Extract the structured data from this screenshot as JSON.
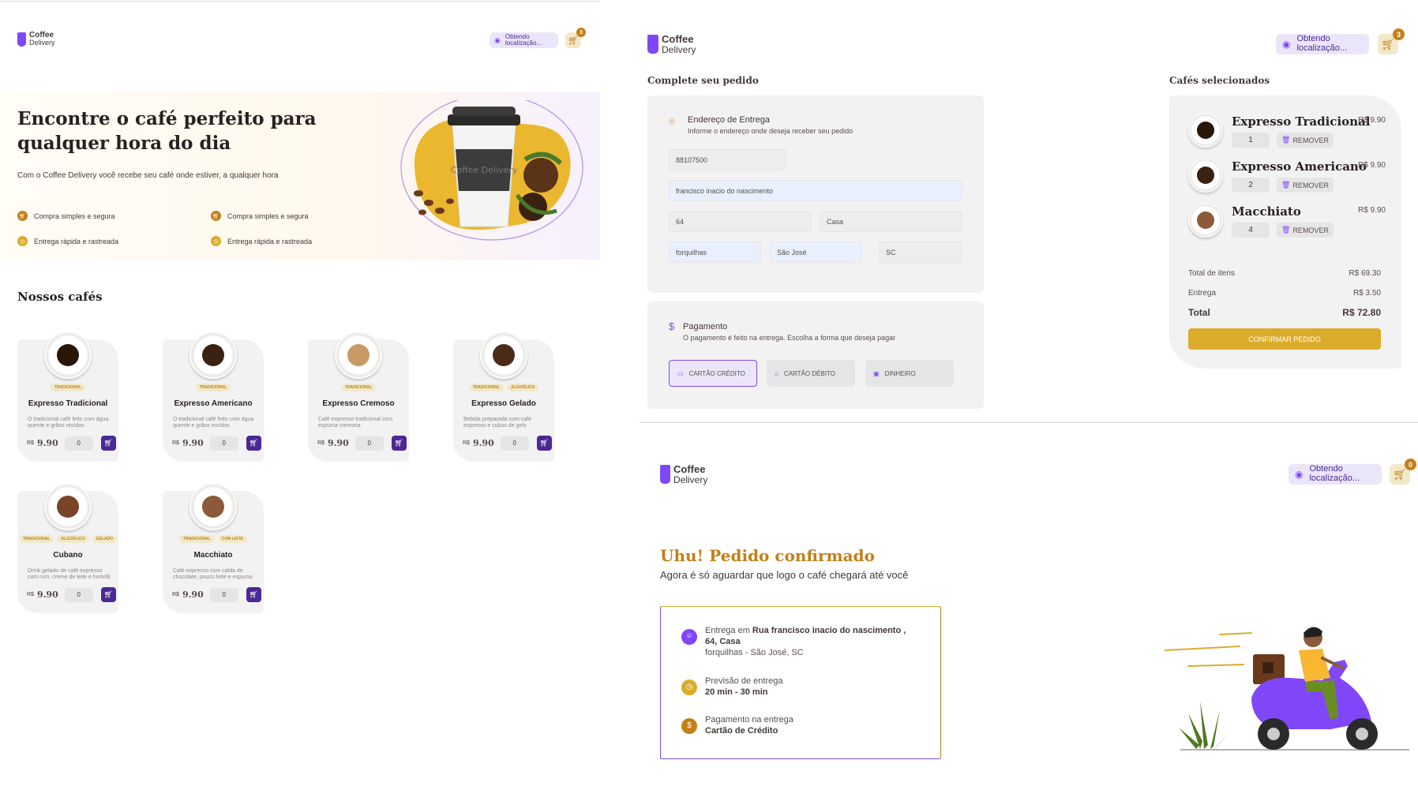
{
  "brand": {
    "line1": "Coffee",
    "line2": "Delivery"
  },
  "header": {
    "location": "Obtendo localização...",
    "cart_count_home": "3",
    "cart_count_checkout": "3",
    "cart_count_success": "0"
  },
  "colors": {
    "purple": "#8047F8",
    "purple_dark": "#4B2995",
    "yellow": "#DBAC2C",
    "yellow_dark": "#C47F17",
    "base_card": "#F3F2F2"
  },
  "home": {
    "hero_title": "Encontre o café perfeito para qualquer hora do dia",
    "hero_subtitle": "Com o Coffee Delivery você recebe seu café onde estiver, a qualquer hora",
    "hero_cup_text": "Coffee Delivery",
    "features": [
      "Compra simples e segura",
      "Compra simples e segura",
      "Entrega rápida e rastreada",
      "Entrega rápida e rastreada"
    ],
    "section_title": "Nossos cafés",
    "currency": "R$",
    "coffees": [
      {
        "name": "Expresso Tradicional",
        "tags": [
          "TRADICIONAL"
        ],
        "description": "O tradicional café feito com água quente e grãos moídos",
        "price": "9.90",
        "qty": "0",
        "color": "#2a1608"
      },
      {
        "name": "Expresso Americano",
        "tags": [
          "TRADICIONAL"
        ],
        "description": "O tradicional café feito com água quente e grãos moídos",
        "price": "9.90",
        "qty": "0",
        "color": "#3b2112"
      },
      {
        "name": "Expresso Cremoso",
        "tags": [
          "TRADICIONAL"
        ],
        "description": "Café expresso tradicional com espuma cremosa",
        "price": "9.90",
        "qty": "0",
        "color": "#c79a66"
      },
      {
        "name": "Expresso Gelado",
        "tags": [
          "TRADICIONAL",
          "ALGOÓLICO"
        ],
        "description": "Bebida preparada com café expresso e cubos de gelo",
        "price": "9.90",
        "qty": "0",
        "color": "#4a2b16"
      },
      {
        "name": "Cubano",
        "tags": [
          "TRADICIONAL",
          "ALGOÓLICO",
          "GELADO"
        ],
        "description": "Drink gelado de café expresso com rum, creme de leite e hortelã",
        "price": "9.90",
        "qty": "0",
        "color": "#7a4428"
      },
      {
        "name": "Macchiato",
        "tags": [
          "TRADICIONAL",
          "COM LEITE"
        ],
        "description": "Café expresso com calda de chocolate, pouco leite e espuma",
        "price": "9.90",
        "qty": "0",
        "color": "#8c5a3a"
      }
    ]
  },
  "checkout": {
    "title": "Complete seu pedido",
    "address_title": "Endereço de Entrega",
    "address_subtitle": "Informe o endereço onde deseja receber seu pedido",
    "fields": {
      "cep": "88107500",
      "street": "francisco inacio do nascimento",
      "number": "64",
      "complement": "Casa",
      "district": "forquilhas",
      "city": "São José",
      "uf": "SC"
    },
    "payment_title": "Pagamento",
    "payment_subtitle": "O pagamento é feito na entrega. Escolha a forma que deseja pagar",
    "payment_options": [
      "CARTÃO CRÉDITO",
      "CARTÃO DÉBITO",
      "DINHEIRO"
    ],
    "selected_title": "Cafés selecionados",
    "items": [
      {
        "name": "Expresso Tradicional",
        "price": "R$ 9.90",
        "qty": "1",
        "color": "#2a1608"
      },
      {
        "name": "Expresso Americano",
        "price": "R$ 9.90",
        "qty": "2",
        "color": "#3b2112"
      },
      {
        "name": "Macchiato",
        "price": "R$ 9.90",
        "qty": "4",
        "color": "#8c5a3a"
      }
    ],
    "remove_label": "REMOVER",
    "summary": {
      "items_label": "Total de itens",
      "items_value": "R$ 69.30",
      "delivery_label": "Entrega",
      "delivery_value": "R$ 3.50",
      "total_label": "Total",
      "total_value": "R$ 72.80"
    },
    "confirm_label": "CONFIRMAR PEDIDO"
  },
  "success": {
    "title": "Uhu! Pedido confirmado",
    "subtitle": "Agora é só aguardar que logo o café chegará até você",
    "delivery_prefix": "Entrega em ",
    "delivery_street": "Rua francisco inacio do nascimento , 64, Casa",
    "delivery_city": "forquilhas - São José, SC",
    "forecast_label": "Previsão de entrega",
    "forecast_value": "20 min - 30 min",
    "payment_label": "Pagamento na entrega",
    "payment_value": "Cartão de Crédito"
  }
}
